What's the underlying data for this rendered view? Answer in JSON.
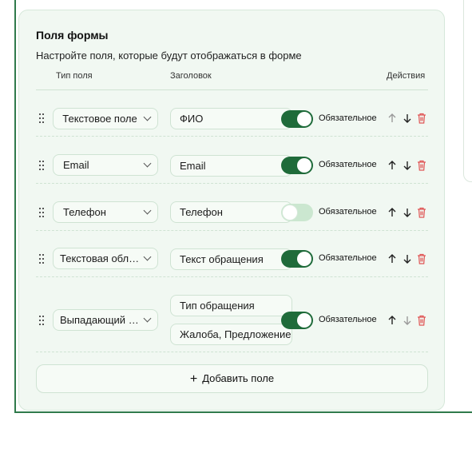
{
  "panel": {
    "title": "Поля формы",
    "subtitle": "Настройте поля, которые будут отображаться в форме"
  },
  "headers": {
    "type": "Тип поля",
    "label": "Заголовок",
    "actions": "Действия"
  },
  "rows": [
    {
      "type": "Текстовое поле",
      "title": "ФИО",
      "required": true,
      "required_label": "Обязательное",
      "can_move_up": false,
      "can_move_down": true
    },
    {
      "type": "Email",
      "title": "Email",
      "required": true,
      "required_label": "Обязательное",
      "can_move_up": true,
      "can_move_down": true
    },
    {
      "type": "Телефон",
      "title": "Телефон",
      "required": false,
      "required_label": "Обязательное",
      "can_move_up": true,
      "can_move_down": true
    },
    {
      "type": "Текстовая область",
      "title": "Текст обращения",
      "required": true,
      "required_label": "Обязательное",
      "can_move_up": true,
      "can_move_down": true
    },
    {
      "type": "Выпадающий список",
      "title": "Тип обращения",
      "options": "Жалоба, Предложение",
      "required": true,
      "required_label": "Обязательное",
      "can_move_up": true,
      "can_move_down": false
    }
  ],
  "add_button": {
    "label": "Добавить поле"
  },
  "colors": {
    "accent": "#1f6b3a",
    "panel_bg": "#f1f8f2",
    "delete": "#e05555",
    "toggle_off": "#cbe7d0"
  },
  "icons": [
    "drag-handle-icon",
    "chevron-down-icon",
    "arrow-up-icon",
    "arrow-down-icon",
    "trash-icon",
    "plus-icon"
  ]
}
